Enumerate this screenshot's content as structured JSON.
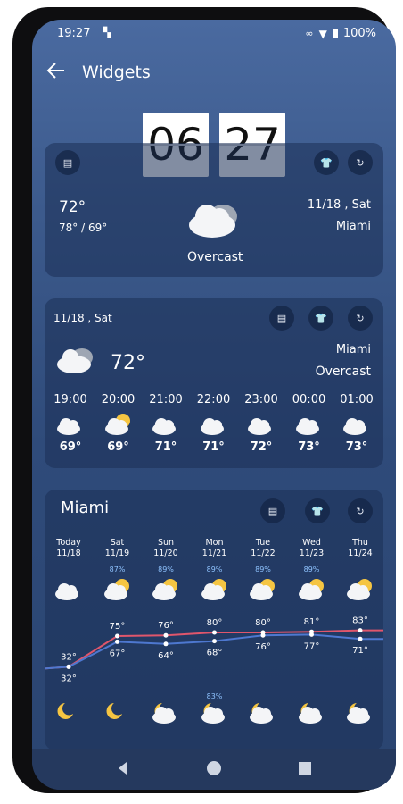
{
  "status": {
    "time": "19:27",
    "battery": "100%"
  },
  "appbar": {
    "title": "Widgets"
  },
  "clock": {
    "hours": "06",
    "minutes": "27"
  },
  "widget1": {
    "temp": "72°",
    "hilo": "78° / 69°",
    "date": "11/18 , Sat",
    "city": "Miami",
    "condition": "Overcast"
  },
  "widget2": {
    "date": "11/18 , Sat",
    "temp": "72°",
    "city": "Miami",
    "condition": "Overcast",
    "hours": [
      {
        "time": "19:00",
        "temp": "69°",
        "icon": "partly-cloudy-night-icon"
      },
      {
        "time": "20:00",
        "temp": "69°",
        "icon": "partly-sunny-icon"
      },
      {
        "time": "21:00",
        "temp": "71°",
        "icon": "cloud-icon"
      },
      {
        "time": "22:00",
        "temp": "71°",
        "icon": "cloud-icon"
      },
      {
        "time": "23:00",
        "temp": "72°",
        "icon": "cloud-icon"
      },
      {
        "time": "00:00",
        "temp": "73°",
        "icon": "cloud-icon"
      },
      {
        "time": "01:00",
        "temp": "73°",
        "icon": "cloud-icon"
      }
    ]
  },
  "widget3": {
    "city": "Miami",
    "days": [
      {
        "day": "Today",
        "date": "11/18",
        "precip": "",
        "high": "32°",
        "low": "32°"
      },
      {
        "day": "Sat",
        "date": "11/19",
        "precip": "87%",
        "high": "75°",
        "low": "67°"
      },
      {
        "day": "Sun",
        "date": "11/20",
        "precip": "89%",
        "high": "76°",
        "low": "64°"
      },
      {
        "day": "Mon",
        "date": "11/21",
        "precip": "89%",
        "high": "80°",
        "low": "68°"
      },
      {
        "day": "Tue",
        "date": "11/22",
        "precip": "89%",
        "high": "80°",
        "low": "76°"
      },
      {
        "day": "Wed",
        "date": "11/23",
        "precip": "89%",
        "high": "81°",
        "low": "77°"
      },
      {
        "day": "Thu",
        "date": "11/24",
        "precip": "",
        "high": "83°",
        "low": "71°"
      }
    ],
    "night_precip_mon": "83%"
  },
  "colors": {
    "high_line": "#e0566c",
    "low_line": "#4e78d0",
    "sun": "#f5c542"
  }
}
